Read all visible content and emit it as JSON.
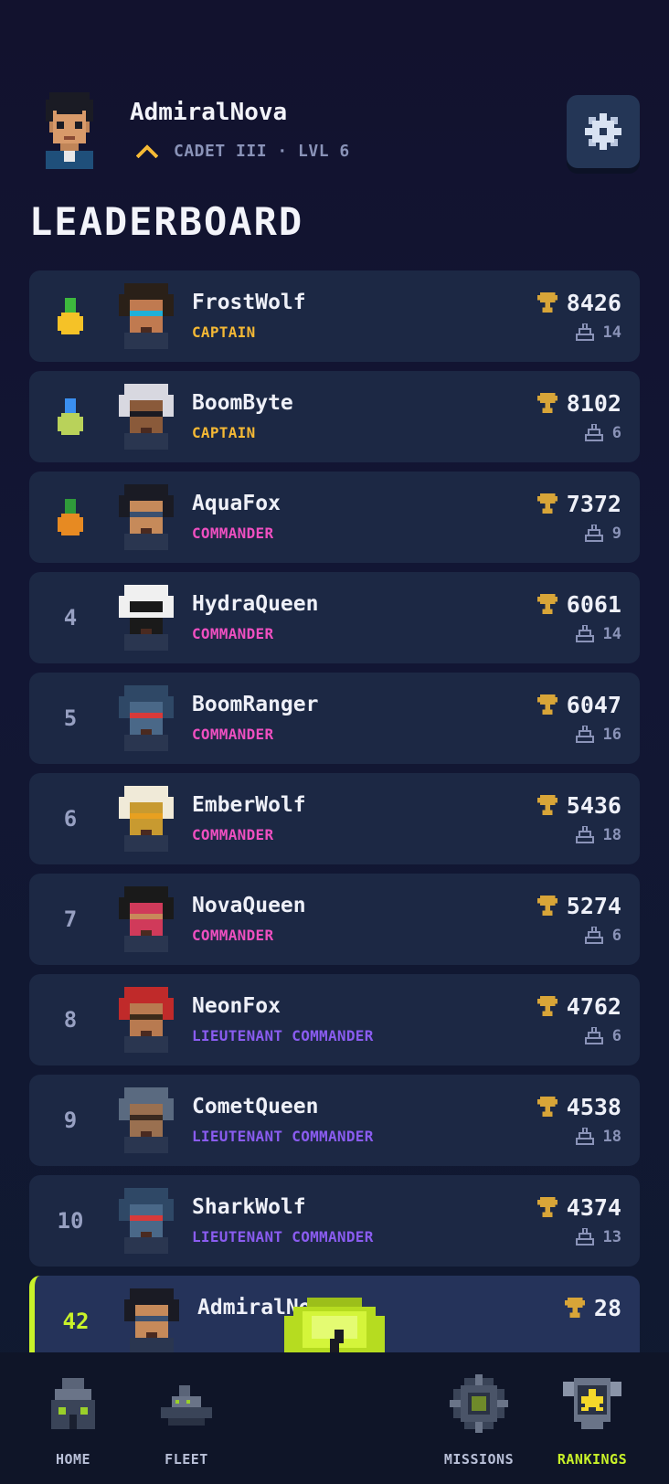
{
  "header": {
    "username": "AdmiralNova",
    "rank_line": "CADET III · LVL 6"
  },
  "title": "LEADERBOARD",
  "colors": {
    "captain": "#f5b935",
    "commander": "#ee4fc0",
    "lieutenant_commander": "#8a5cf0",
    "accent": "#c9f229",
    "trophy": "#d8a538"
  },
  "players": [
    {
      "position": "",
      "medal": "gold-medal",
      "name": "FrostWolf",
      "rank": "CAPTAIN",
      "rank_color": "#f5b935",
      "score": "8426",
      "ships": "14"
    },
    {
      "position": "",
      "medal": "silver-medal",
      "name": "BoomByte",
      "rank": "CAPTAIN",
      "rank_color": "#f5b935",
      "score": "8102",
      "ships": "6"
    },
    {
      "position": "",
      "medal": "bronze-medal",
      "name": "AquaFox",
      "rank": "COMMANDER",
      "rank_color": "#ee4fc0",
      "score": "7372",
      "ships": "9"
    },
    {
      "position": "4",
      "name": "HydraQueen",
      "rank": "COMMANDER",
      "rank_color": "#ee4fc0",
      "score": "6061",
      "ships": "14"
    },
    {
      "position": "5",
      "name": "BoomRanger",
      "rank": "COMMANDER",
      "rank_color": "#ee4fc0",
      "score": "6047",
      "ships": "16"
    },
    {
      "position": "6",
      "name": "EmberWolf",
      "rank": "COMMANDER",
      "rank_color": "#ee4fc0",
      "score": "5436",
      "ships": "18"
    },
    {
      "position": "7",
      "name": "NovaQueen",
      "rank": "COMMANDER",
      "rank_color": "#ee4fc0",
      "score": "5274",
      "ships": "6"
    },
    {
      "position": "8",
      "name": "NeonFox",
      "rank": "LIEUTENANT COMMANDER",
      "rank_color": "#8a5cf0",
      "score": "4762",
      "ships": "6"
    },
    {
      "position": "9",
      "name": "CometQueen",
      "rank": "LIEUTENANT COMMANDER",
      "rank_color": "#8a5cf0",
      "score": "4538",
      "ships": "18"
    },
    {
      "position": "10",
      "name": "SharkWolf",
      "rank": "LIEUTENANT COMMANDER",
      "rank_color": "#8a5cf0",
      "score": "4374",
      "ships": "13"
    },
    {
      "position": "42",
      "name": "AdmiralNova",
      "rank": "",
      "rank_color": "#8a93b8",
      "score": "28",
      "ships": "",
      "is_me": true
    }
  ],
  "nav": {
    "home": "HOME",
    "fleet": "FLEET",
    "missions": "MISSIONS",
    "rankings": "RANKINGS",
    "active": "rankings"
  }
}
